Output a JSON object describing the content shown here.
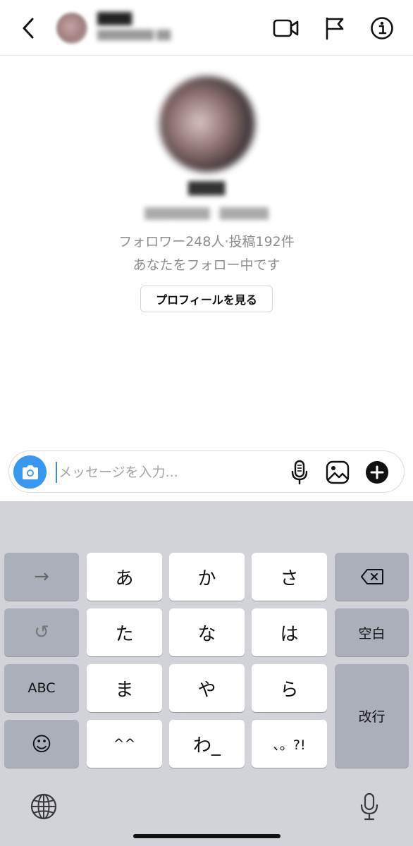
{
  "header": {
    "contact_name": "████",
    "contact_subtitle": "████████ ██",
    "icons": [
      "back-chevron-icon",
      "video-call-icon",
      "flag-icon",
      "info-icon"
    ]
  },
  "profile": {
    "name": "████",
    "handle": "████████ · ██████",
    "stats": "フォロワー248人·投稿192件",
    "follow_status": "あなたをフォロー中です",
    "view_profile_label": "プロフィールを見る"
  },
  "composer": {
    "placeholder": "メッセージを入力...",
    "value": "",
    "icons": [
      "camera-icon",
      "microphone-icon",
      "gallery-icon",
      "plus-icon"
    ],
    "camera_color": "#3897f0"
  },
  "keyboard": {
    "next_label": "→",
    "undo_label": "↺",
    "abc_label": "ABC",
    "emoji_label": "☺",
    "rows": [
      [
        "あ",
        "か",
        "さ"
      ],
      [
        "た",
        "な",
        "は"
      ],
      [
        "ま",
        "や",
        "ら"
      ],
      [
        "^^",
        "わ_",
        "、。?!"
      ]
    ],
    "delete_icon": "backspace-icon",
    "space_label": "空白",
    "return_label": "改行",
    "globe_icon": "globe-icon",
    "dictation_icon": "microphone-icon"
  },
  "colors": {
    "accent": "#3897f0",
    "keyboard_bg": "#d1d3d9",
    "function_key": "#abafb9",
    "secondary_text": "#8e8e8e"
  }
}
